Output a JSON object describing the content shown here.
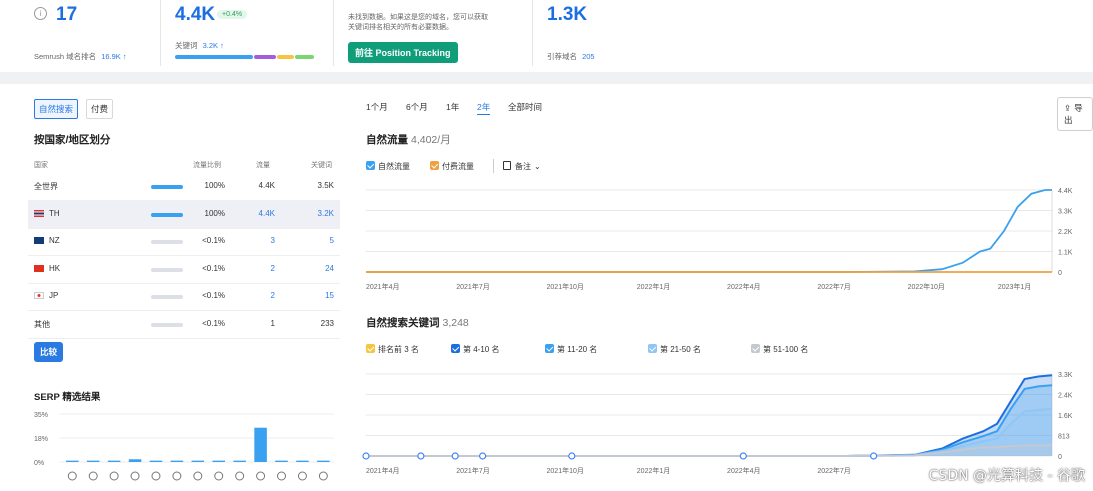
{
  "top": {
    "card1": {
      "value": "17",
      "label": "Semrush 域名排名",
      "label_value": "16.9K ↑"
    },
    "card2": {
      "value": "4.4K",
      "badge": "+0.4%",
      "label": "关键词",
      "label_value": "3.2K ↑"
    },
    "card3": {
      "note_line1": "未找到数据。如果这是您的域名，您可以获取",
      "note_line2": "关键词排名相关的所有必要数据。",
      "button": "前往 Position Tracking"
    },
    "card4": {
      "value": "1.3K",
      "label": "引荐域名",
      "label_value": "205"
    }
  },
  "left": {
    "tabs": [
      "自然搜索",
      "付费"
    ],
    "title": "按国家/地区划分",
    "headers": [
      "国家",
      "流量比例",
      "流量",
      "关键词"
    ],
    "rows": [
      {
        "country": "全世界",
        "flag": "",
        "share": "100%",
        "share_frac": 1.0,
        "traffic": "4.4K",
        "keywords": "3.5K",
        "highlight": false,
        "link": false
      },
      {
        "country": "TH",
        "flag": "th",
        "share": "100%",
        "share_frac": 1.0,
        "traffic": "4.4K",
        "keywords": "3.2K",
        "highlight": true,
        "link": true
      },
      {
        "country": "NZ",
        "flag": "nz",
        "share": "<0.1%",
        "share_frac": 0.0,
        "traffic": "3",
        "keywords": "5",
        "highlight": false,
        "link": true
      },
      {
        "country": "HK",
        "flag": "hk",
        "share": "<0.1%",
        "share_frac": 0.0,
        "traffic": "2",
        "keywords": "24",
        "highlight": false,
        "link": true
      },
      {
        "country": "JP",
        "flag": "jp",
        "share": "<0.1%",
        "share_frac": 0.0,
        "traffic": "2",
        "keywords": "15",
        "highlight": false,
        "link": true
      },
      {
        "country": "其他",
        "flag": "",
        "share": "<0.1%",
        "share_frac": 0.0,
        "traffic": "1",
        "keywords": "233",
        "highlight": false,
        "link": false
      }
    ],
    "compare_button": "比较",
    "serp_title": "SERP 精选结果"
  },
  "right": {
    "ranges": [
      "1个月",
      "6个月",
      "1年",
      "2年",
      "全部时间"
    ],
    "active_range": "2年",
    "export_label": "导出",
    "traffic_title": "自然流量",
    "traffic_sub": "4,402/月",
    "traffic_legend": [
      "自然流量",
      "付费流量",
      "备注"
    ],
    "keywords_title": "自然搜索关键词",
    "keywords_sub": "3,248",
    "keywords_legend": [
      "排名前 3 名",
      "第 4-10 名",
      "第 11-20 名",
      "第 21-50 名",
      "第 51-100 名"
    ]
  },
  "colors": {
    "accent": "#2a7ae2",
    "organic": "#3aa1f0",
    "paid": "#f0a040",
    "top3": "#f5c542",
    "pos4_10": "#1b6fe0",
    "pos11_20": "#3aa1f0",
    "pos21_50": "#8fc6f5",
    "pos51_100": "#c4c8d0",
    "bar": "#3aa1f0"
  },
  "chart_data": [
    {
      "type": "line",
      "title": "自然流量",
      "x_ticks": [
        "2021年4月",
        "2021年7月",
        "2021年10月",
        "2022年1月",
        "2022年4月",
        "2022年7月",
        "2022年10月",
        "2023年1月"
      ],
      "y_ticks": [
        "0",
        "1.1K",
        "2.2K",
        "3.3K",
        "4.4K"
      ],
      "ylim": [
        0,
        4400
      ],
      "x": [
        0,
        0.1,
        0.2,
        0.3,
        0.4,
        0.5,
        0.6,
        0.7,
        0.8,
        0.84,
        0.87,
        0.895,
        0.91,
        0.93,
        0.95,
        0.97,
        0.99,
        1.0
      ],
      "series": [
        {
          "name": "自然流量",
          "values": [
            0,
            0,
            0,
            0,
            0,
            0,
            0,
            0,
            30,
            150,
            500,
            1100,
            1250,
            2200,
            3500,
            4200,
            4400,
            4402
          ]
        },
        {
          "name": "付费流量",
          "values": [
            0,
            0,
            0,
            0,
            0,
            0,
            0,
            0,
            0,
            0,
            0,
            0,
            0,
            0,
            0,
            0,
            0,
            0
          ]
        }
      ]
    },
    {
      "type": "area",
      "title": "自然搜索关键词",
      "x_ticks": [
        "2021年4月",
        "2021年7月",
        "2021年10月",
        "2022年1月",
        "2022年4月",
        "2022年7月"
      ],
      "y_ticks": [
        "0",
        "813",
        "1.6K",
        "2.4K",
        "3.3K"
      ],
      "ylim": [
        0,
        3300
      ],
      "x": [
        0,
        0.1,
        0.2,
        0.3,
        0.4,
        0.5,
        0.6,
        0.7,
        0.8,
        0.84,
        0.87,
        0.9,
        0.92,
        0.94,
        0.96,
        0.98,
        1.0
      ],
      "series": [
        {
          "name": "第 4-10 名",
          "values": [
            0,
            0,
            0,
            0,
            0,
            0,
            0,
            0,
            50,
            300,
            700,
            1000,
            1300,
            2200,
            3100,
            3200,
            3248
          ]
        },
        {
          "name": "第 11-20 名",
          "values": [
            0,
            0,
            0,
            0,
            0,
            0,
            0,
            0,
            40,
            250,
            550,
            800,
            1000,
            1900,
            2700,
            2800,
            2850
          ]
        },
        {
          "name": "第 21-50 名",
          "values": [
            0,
            0,
            0,
            0,
            0,
            0,
            0,
            0,
            30,
            200,
            400,
            600,
            700,
            1300,
            1800,
            1850,
            1900
          ]
        },
        {
          "name": "第 51-100 名",
          "values": [
            0,
            0,
            0,
            0,
            0,
            0,
            0,
            0,
            20,
            150,
            250,
            350,
            350,
            400,
            420,
            430,
            440
          ]
        }
      ]
    },
    {
      "type": "bar",
      "title": "SERP 精选结果",
      "y_ticks": [
        "0%",
        "18%",
        "35%"
      ],
      "ylim": [
        0,
        35
      ],
      "values": [
        1,
        1,
        1,
        2,
        1,
        1,
        1,
        1,
        1,
        25,
        1,
        1,
        1
      ]
    }
  ],
  "watermark": "CSDN @光算科技 - 谷歌"
}
